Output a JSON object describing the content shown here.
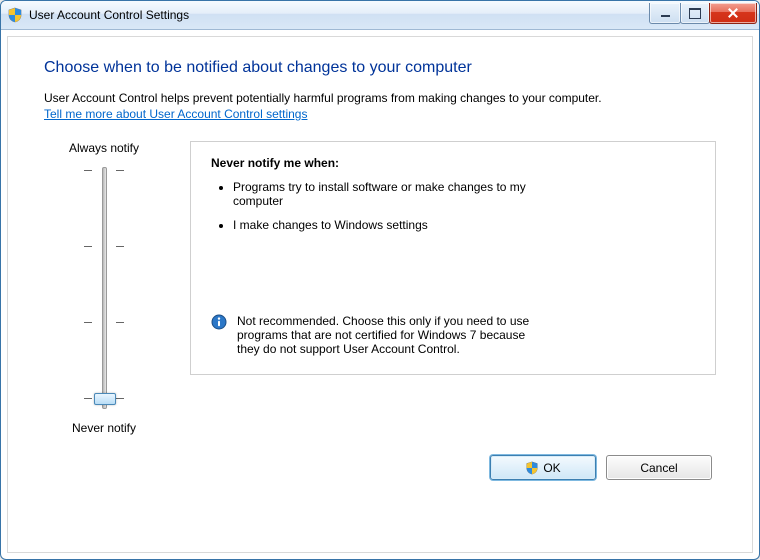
{
  "window": {
    "title": "User Account Control Settings"
  },
  "heading": "Choose when to be notified about changes to your computer",
  "description": "User Account Control helps prevent potentially harmful programs from making changes to your computer.",
  "help_link": "Tell me more about User Account Control settings",
  "slider": {
    "labels": {
      "top": "Always notify",
      "bottom": "Never notify"
    },
    "levels": 4,
    "current_level_index": 3
  },
  "info": {
    "title": "Never notify me when:",
    "bullets": [
      "Programs try to install software or make changes to my computer",
      "I make changes to Windows settings"
    ],
    "recommendation": "Not recommended. Choose this only if you need to use programs that are not certified for Windows 7 because they do not support User Account Control."
  },
  "buttons": {
    "ok": "OK",
    "cancel": "Cancel"
  }
}
